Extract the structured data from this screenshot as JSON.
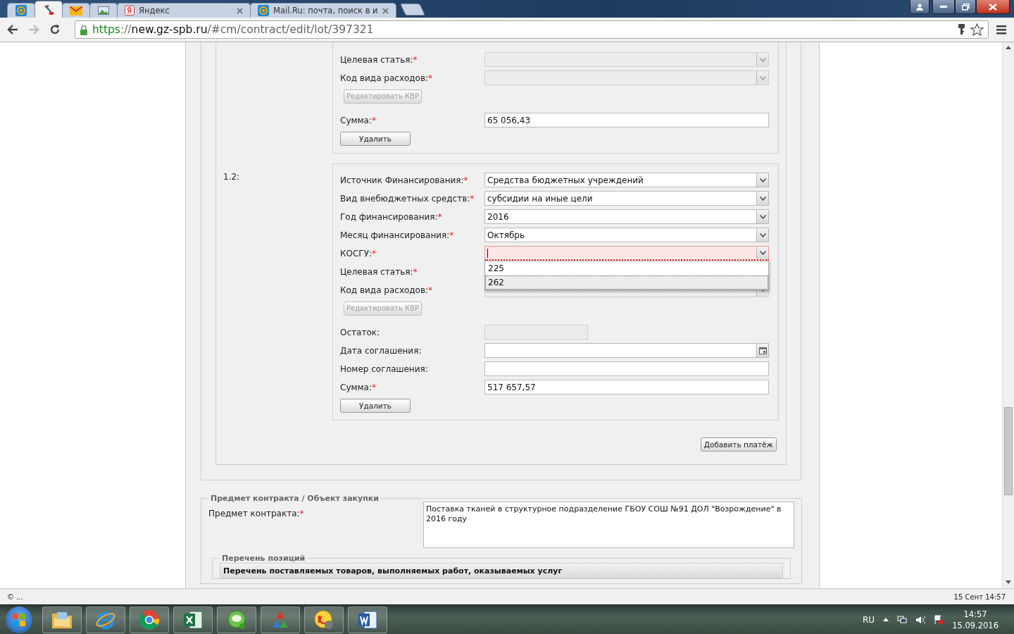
{
  "browser": {
    "tabs": [
      {
        "kind": "mailru",
        "selected": false
      },
      {
        "kind": "tool",
        "selected": true
      },
      {
        "kind": "envelope",
        "selected": false
      },
      {
        "kind": "image",
        "selected": false
      },
      {
        "kind": "yandex",
        "title": "Яндекс",
        "selected": false
      },
      {
        "kind": "mailru",
        "title": "Mail.Ru: почта, поиск в и",
        "selected": false
      }
    ],
    "address": [
      {
        "kind": "scheme",
        "text": "https"
      },
      {
        "kind": "sep",
        "text": "://"
      },
      {
        "kind": "host",
        "text": "new.gz-spb.ru"
      },
      {
        "kind": "path",
        "text": "/#cm/contract/edit/lot/397321"
      }
    ]
  },
  "payments": [
    {
      "fields": [
        {
          "kind": "select",
          "label": "Целевая статья:",
          "mark": "*",
          "disabled": true,
          "error": false
        },
        {
          "kind": "select",
          "label": "Код вида расходов:",
          "mark": "*",
          "disabled": true,
          "error": false
        },
        {
          "kind": "button",
          "label": "Редактировать КВР",
          "disabled": true
        },
        {
          "kind": "text",
          "label": "Сумма:",
          "mark": "*",
          "value": "65 056,43",
          "disabled": false
        }
      ],
      "delete_button": "Удалить"
    },
    {
      "number": "1.2:",
      "fields": [
        {
          "kind": "select",
          "label": "Источник Финансирования:",
          "mark": "*",
          "value": "Средства бюджетных учреждений",
          "disabled": false,
          "error": false
        },
        {
          "kind": "select",
          "label": "Вид внебюджетных средств:",
          "mark": "*",
          "value": "субсидии на иные цели",
          "disabled": false,
          "error": false
        },
        {
          "kind": "select",
          "label": "Год финансирования:",
          "mark": "*",
          "value": "2016",
          "disabled": false,
          "error": false
        },
        {
          "kind": "select",
          "label": "Месяц финансирования:",
          "mark": "*",
          "value": "Октябрь",
          "disabled": false,
          "error": false
        },
        {
          "kind": "select",
          "label": "КОСГУ:",
          "mark": "*",
          "disabled": false,
          "error": true,
          "focused": true,
          "options": [
            {
              "label": "225",
              "selected": false
            },
            {
              "label": "262",
              "selected": true
            }
          ]
        },
        {
          "kind": "covered",
          "label": "Целевая статья:",
          "mark": "*"
        },
        {
          "kind": "select",
          "label": "Код вида расходов:",
          "mark": "*",
          "disabled": true,
          "error": false
        },
        {
          "kind": "button",
          "label": "Редактировать КВР",
          "disabled": true
        },
        {
          "kind": "short",
          "label": "Остаток:",
          "disabled": true
        },
        {
          "kind": "date",
          "label": "Дата соглашения:",
          "disabled": false
        },
        {
          "kind": "text",
          "label": "Номер соглашения:",
          "disabled": false
        },
        {
          "kind": "text",
          "label": "Сумма:",
          "mark": "*",
          "value": "517 657,57",
          "disabled": false
        }
      ],
      "delete_button": "Удалить"
    }
  ],
  "add_payment_button": "Добавить платёж",
  "subject": {
    "legend": "Предмет контракта / Объект закупки",
    "label": "Предмет контракта:",
    "mark": "*",
    "value": "Поставка тканей в структурное подразделение ГБОУ СОШ №91 ДОЛ \"Возрождение\" в 2016 году"
  },
  "positions": {
    "legend": "Перечень позиций",
    "header": "Перечень поставляемых товаров, выполняемых работ, оказываемых услуг"
  },
  "status_bar": {
    "left": "© ...",
    "right": "15 Сент 14:57"
  },
  "taskbar": {
    "apps": [
      {
        "kind": "explorer"
      },
      {
        "kind": "ie"
      },
      {
        "kind": "chrome"
      },
      {
        "kind": "excel"
      },
      {
        "kind": "chat"
      },
      {
        "kind": "recycle"
      },
      {
        "kind": "onec"
      },
      {
        "kind": "word"
      }
    ],
    "language": "RU",
    "time": "14:57",
    "date": "15.09.2016"
  }
}
